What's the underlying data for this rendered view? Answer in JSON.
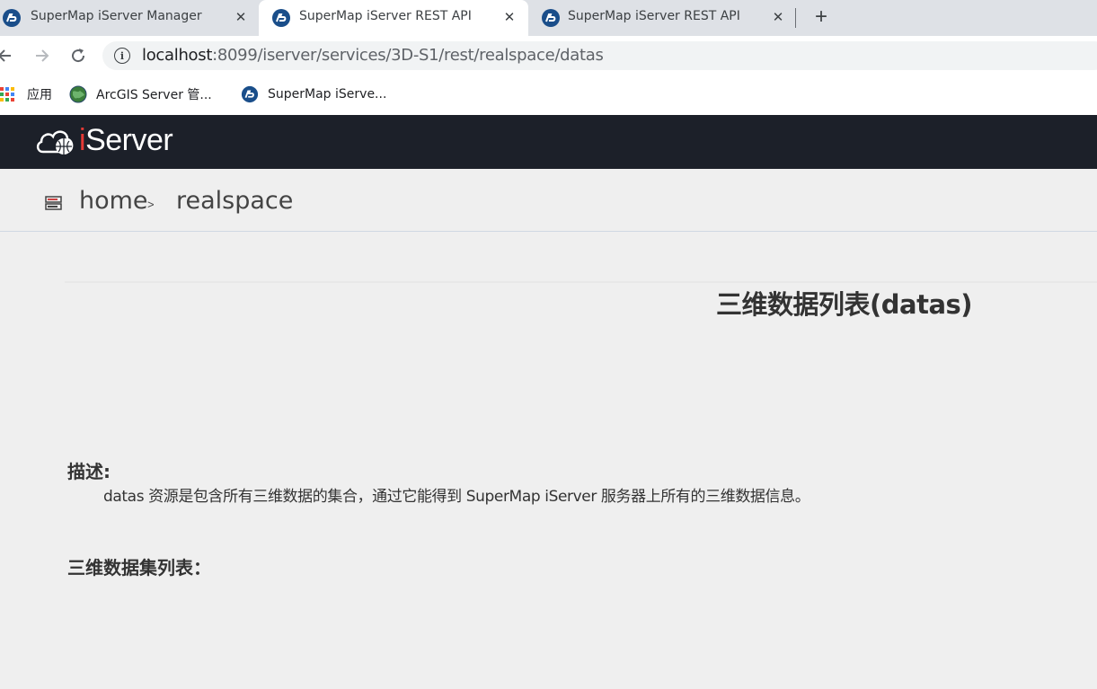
{
  "browser": {
    "tabs": [
      {
        "title": "SuperMap iServer Manager",
        "active": false
      },
      {
        "title": "SuperMap iServer REST API",
        "active": true
      },
      {
        "title": "SuperMap iServer REST API",
        "active": false
      }
    ],
    "address": {
      "host": "localhost",
      "rest": ":8099/iserver/services/3D-S1/rest/realspace/datas"
    },
    "bookmarks": [
      {
        "label": "应用",
        "icon": "apps-grid-icon"
      },
      {
        "label": "ArcGIS Server 管...",
        "icon": "arcgis-globe-icon"
      },
      {
        "label": "SuperMap iServe...",
        "icon": "supermap-icon"
      }
    ]
  },
  "site": {
    "logo_text_i": "i",
    "logo_text_rest": "Server"
  },
  "breadcrumb": {
    "home": "home",
    "separator": ">",
    "current": "realspace"
  },
  "content": {
    "title": "三维数据列表(datas)",
    "description_label": "描述:",
    "description_text": "datas 资源是包含所有三维数据的集合，通过它能得到 SuperMap iServer 服务器上所有的三维数据信息。",
    "list_label": "三维数据集列表："
  },
  "colors": {
    "header_bg": "#1c2029",
    "page_bg": "#efefef",
    "tabstrip_bg": "#dee1e6",
    "brand_accent": "#e53935"
  }
}
